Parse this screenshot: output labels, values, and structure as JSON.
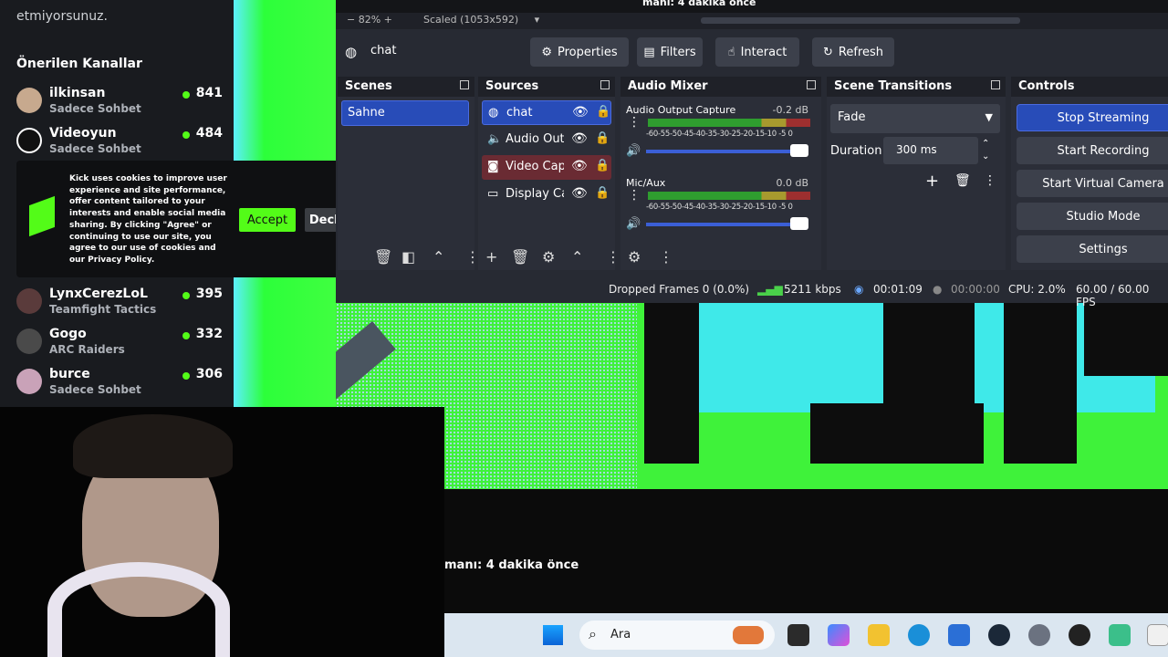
{
  "kick": {
    "top_text": "etmiyorsunuz.",
    "section_title": "Önerilen Kanallar",
    "channels": [
      {
        "name": "ilkinsan",
        "category": "Sadece Sohbet",
        "viewers": "841"
      },
      {
        "name": "Videoyun",
        "category": "Sadece Sohbet",
        "viewers": "484"
      },
      {
        "name": "LynxCerezLoL",
        "category": "Teamfight Tactics",
        "viewers": "395"
      },
      {
        "name": "Gogo",
        "category": "ARC Raiders",
        "viewers": "332"
      },
      {
        "name": "burce",
        "category": "Sadece Sohbet",
        "viewers": "306"
      }
    ],
    "live_color": "#53fc18"
  },
  "cookie": {
    "text": "Kick uses cookies to improve user experience and site performance, offer content tailored to your interests and enable social media sharing. By clicking \"Agree\" or continuing to use our site, you agree to our use of cookies and our Privacy Policy.",
    "accept": "Accept",
    "decline": "Decline"
  },
  "obs": {
    "zoom": "82%",
    "scaled": "Scaled (1053x592)",
    "preview_text": "manı: 4 dakika önce",
    "selected_source": "chat",
    "toolbar": {
      "properties": "Properties",
      "filters": "Filters",
      "interact": "Interact",
      "refresh": "Refresh"
    },
    "docks": {
      "scenes": "Scenes",
      "sources": "Sources",
      "audio_mixer": "Audio Mixer",
      "scene_transitions": "Scene Transitions",
      "controls": "Controls"
    },
    "scenes": [
      "Sahne"
    ],
    "sources": [
      {
        "label": "chat",
        "icon": "globe-icon"
      },
      {
        "label": "Audio Out",
        "icon": "speaker-icon"
      },
      {
        "label": "Video Cap",
        "icon": "camera-icon"
      },
      {
        "label": "Display Ca",
        "icon": "monitor-icon"
      }
    ],
    "mixer": [
      {
        "name": "Audio Output Capture",
        "db": "-0.2 dB",
        "level": 0.98
      },
      {
        "name": "Mic/Aux",
        "db": "0.0 dB",
        "level": 0.98
      }
    ],
    "meter_ticks": "-60-55-50-45-40-35-30-25-20-15-10 -5  0",
    "transition": {
      "type": "Fade",
      "duration_label": "Duration",
      "duration": "300 ms"
    },
    "controls": [
      "Stop Streaming",
      "Start Recording",
      "Start Virtual Camera",
      "Studio Mode",
      "Settings"
    ],
    "status": {
      "dropped": "Dropped Frames 0 (0.0%)",
      "bitrate": "5211 kbps",
      "stream_time": "00:01:09",
      "rec_time": "00:00:00",
      "cpu": "CPU: 2.0%",
      "fps": "60.00 / 60.00 FPS"
    },
    "accent": "#284cb8"
  },
  "lower_msg": "manı: 4 dakika önce",
  "taskbar": {
    "search_placeholder": "Ara",
    "icons": [
      "windows-start-icon",
      "search-icon",
      "widgets-icon",
      "task-view-icon",
      "copilot-icon",
      "file-explorer-icon",
      "edge-icon",
      "store-icon",
      "steam-icon",
      "settings-icon",
      "obs-icon",
      "app-icon"
    ]
  }
}
